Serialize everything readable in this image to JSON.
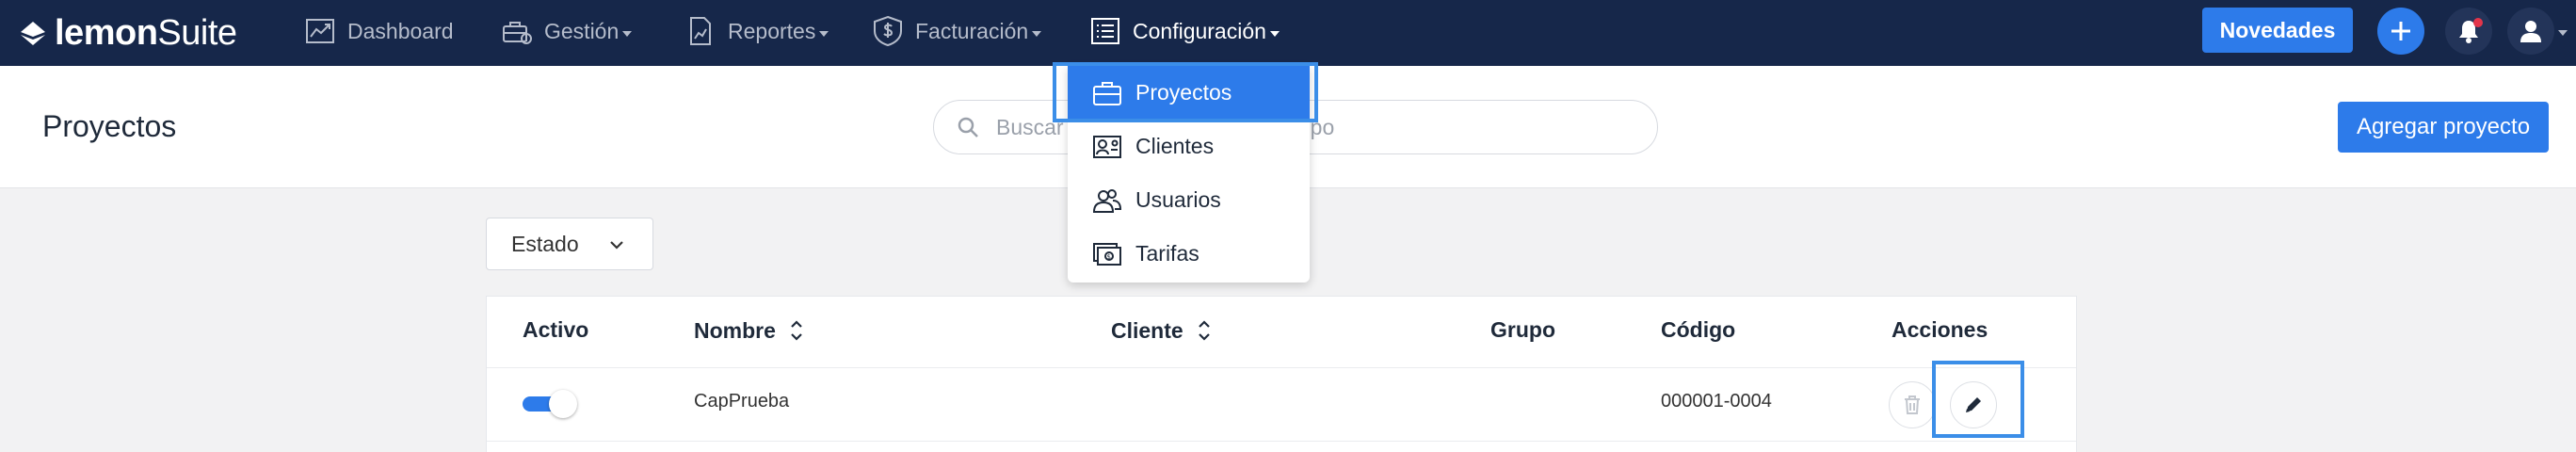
{
  "app": {
    "logo_bold": "lemon",
    "logo_regular": "Suite"
  },
  "nav": {
    "items": [
      {
        "label": "Dashboard",
        "icon": "chart-icon",
        "has_caret": false
      },
      {
        "label": "Gestión",
        "icon": "toolbox-icon",
        "has_caret": true
      },
      {
        "label": "Reportes",
        "icon": "report-icon",
        "has_caret": true
      },
      {
        "label": "Facturación",
        "icon": "dollar-shield-icon",
        "has_caret": true
      },
      {
        "label": "Configuración",
        "icon": "list-icon",
        "has_caret": true
      }
    ],
    "novedades_label": "Novedades"
  },
  "header": {
    "title": "Proyectos",
    "search_placeholder": "Buscar por nombre, cliente o grupo",
    "add_button_label": "Agregar proyecto"
  },
  "filter": {
    "label": "Estado"
  },
  "table": {
    "columns": [
      "Activo",
      "Nombre",
      "Cliente",
      "Grupo",
      "Código",
      "Acciones"
    ],
    "rows": [
      {
        "active": true,
        "nombre": "CapPrueba",
        "cliente": "",
        "grupo": "",
        "codigo": "000001-0004"
      }
    ]
  },
  "dropdown": {
    "items": [
      {
        "label": "Proyectos",
        "icon": "briefcase-icon"
      },
      {
        "label": "Clientes",
        "icon": "contact-card-icon"
      },
      {
        "label": "Usuarios",
        "icon": "users-icon"
      },
      {
        "label": "Tarifas",
        "icon": "money-icon"
      }
    ]
  },
  "colors": {
    "navbar": "#16274a",
    "accent": "#2d7bea",
    "highlight": "#3b8ee8",
    "alert": "#e3354a"
  }
}
